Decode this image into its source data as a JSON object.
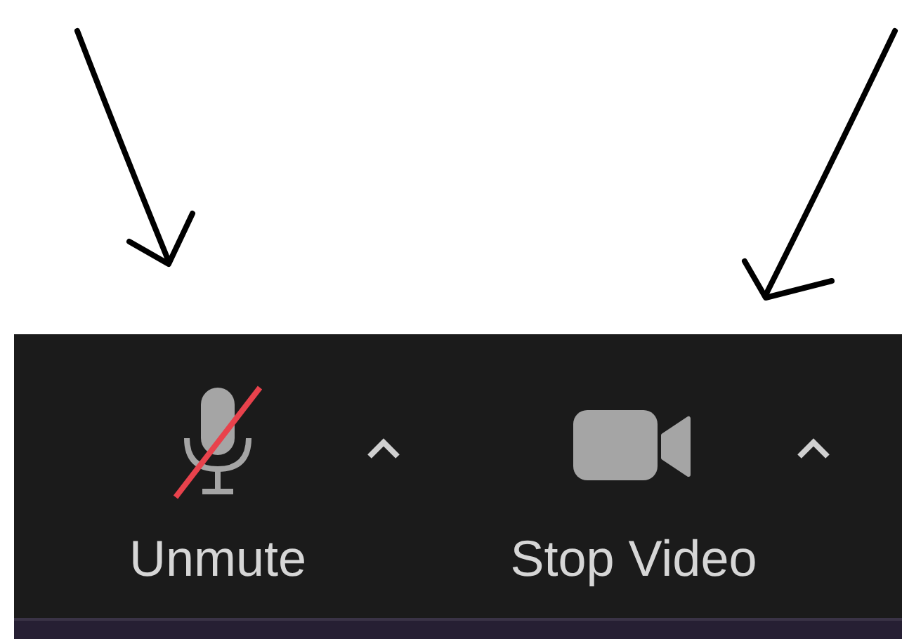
{
  "annotations": [
    {
      "kind": "arrow"
    },
    {
      "kind": "arrow"
    }
  ],
  "toolbar": {
    "buttons": [
      {
        "kind": "microphone",
        "label": "Unmute",
        "muted": true
      },
      {
        "kind": "camera",
        "label": "Stop Video",
        "muted": false
      }
    ]
  }
}
